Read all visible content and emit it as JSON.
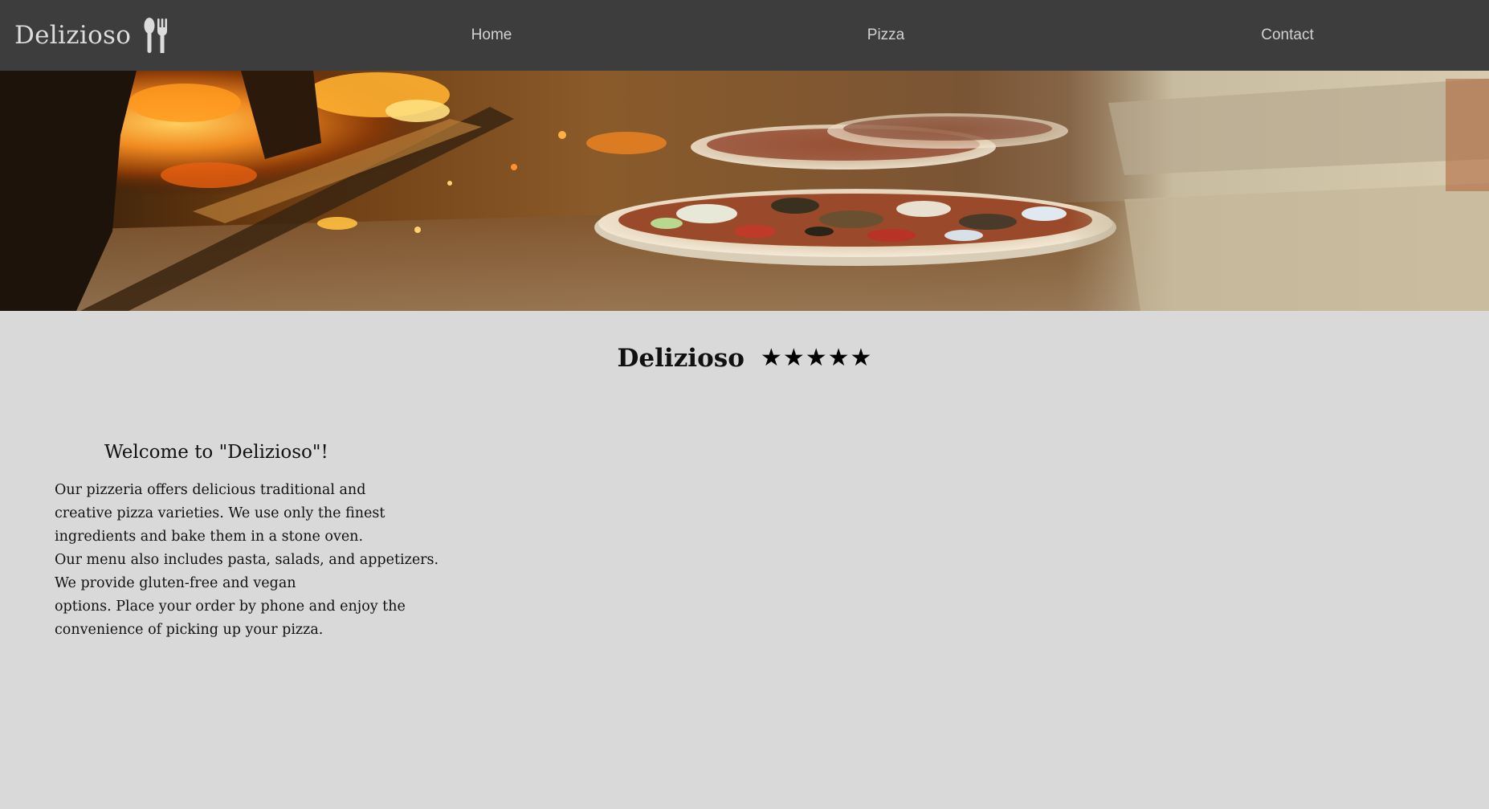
{
  "nav": {
    "brand": "Delizioso",
    "brand_icon": "fork-and-knife-icon",
    "links": [
      {
        "label": "Home"
      },
      {
        "label": "Pizza"
      },
      {
        "label": "Contact"
      }
    ]
  },
  "hero": {
    "image": "wood-fired-pizza-oven-photo"
  },
  "rating": {
    "title": "Delizioso",
    "stars": 5,
    "star_glyph": "★"
  },
  "welcome": {
    "title": "Welcome to \"Delizioso\"!",
    "lines": [
      "Our pizzeria offers delicious traditional and",
      "creative pizza varieties. We use only the finest",
      "ingredients and bake them in a stone oven.",
      "Our menu also includes pasta, salads, and appetizers.",
      "We provide gluten-free and vegan",
      "options. Place your order by phone and enjoy the",
      "convenience of picking up your pizza."
    ]
  },
  "colors": {
    "navbar": "#3d3d3d",
    "page_background": "#d9d9d9",
    "nav_text": "#d2d2d2"
  }
}
